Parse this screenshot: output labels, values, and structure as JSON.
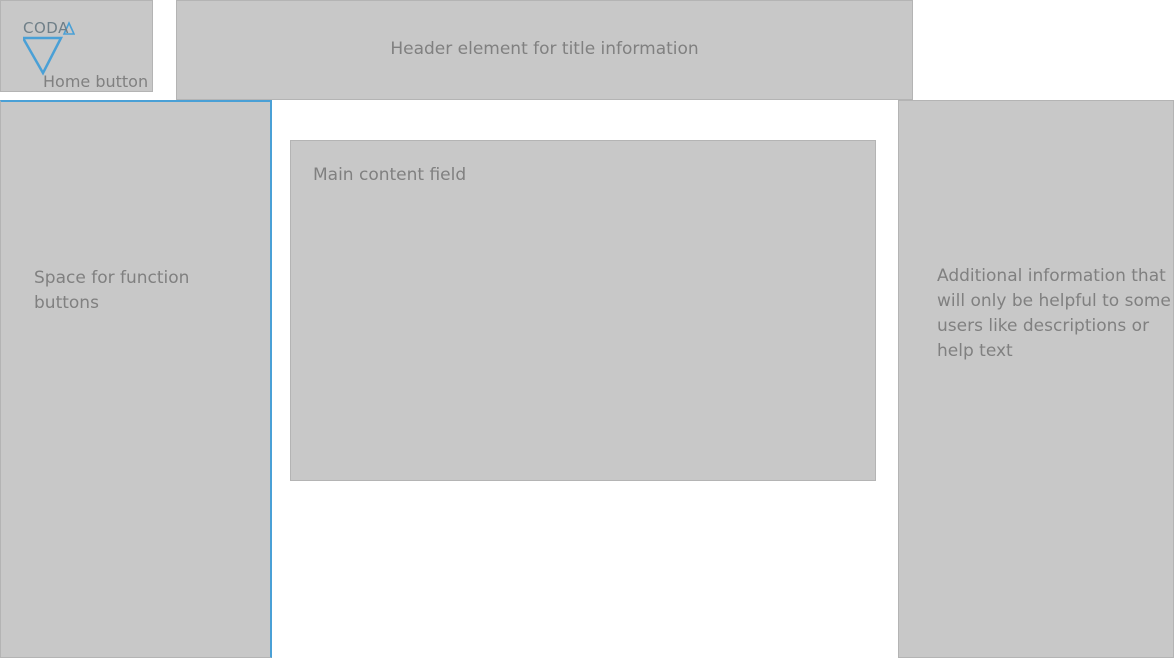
{
  "home": {
    "logo_text": "CODA",
    "label": "Home button"
  },
  "header": {
    "label": "Header element for title information"
  },
  "left_panel": {
    "label": "Space for function buttons"
  },
  "main": {
    "label": "Main content field"
  },
  "right_panel": {
    "label": "Additional information that will only be helpful to some users like descriptions or help text"
  },
  "colors": {
    "panel_fill": "#c8c8c8",
    "accent_blue": "#4aa0d6",
    "text_gray": "#808080"
  },
  "icons": {
    "logo": "coda-triangle-logo-icon"
  }
}
